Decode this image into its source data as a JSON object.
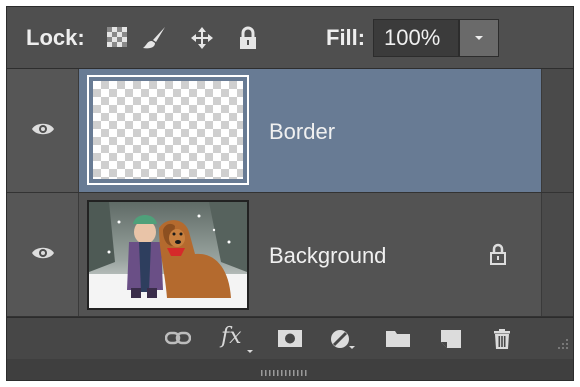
{
  "lock_row": {
    "lock_label": "Lock:",
    "fill_label": "Fill:",
    "fill_value": "100%",
    "icons": [
      "lock-transparent-pixels-icon",
      "lock-image-pixels-icon",
      "lock-position-icon",
      "lock-all-icon"
    ]
  },
  "layers": [
    {
      "name": "Border",
      "selected": true,
      "visible": true,
      "locked": false
    },
    {
      "name": "Background",
      "selected": false,
      "visible": true,
      "locked": true
    }
  ],
  "toolbar": {
    "fx_label": "fx",
    "icons": [
      "link-layers-icon",
      "layer-style-icon",
      "layer-mask-icon",
      "adjustment-layer-icon",
      "new-group-icon",
      "new-layer-icon",
      "delete-layer-icon"
    ]
  },
  "colors": {
    "panel_bg": "#4f4f4f",
    "selected_layer": "#687b94",
    "text": "#f0f0f0"
  }
}
